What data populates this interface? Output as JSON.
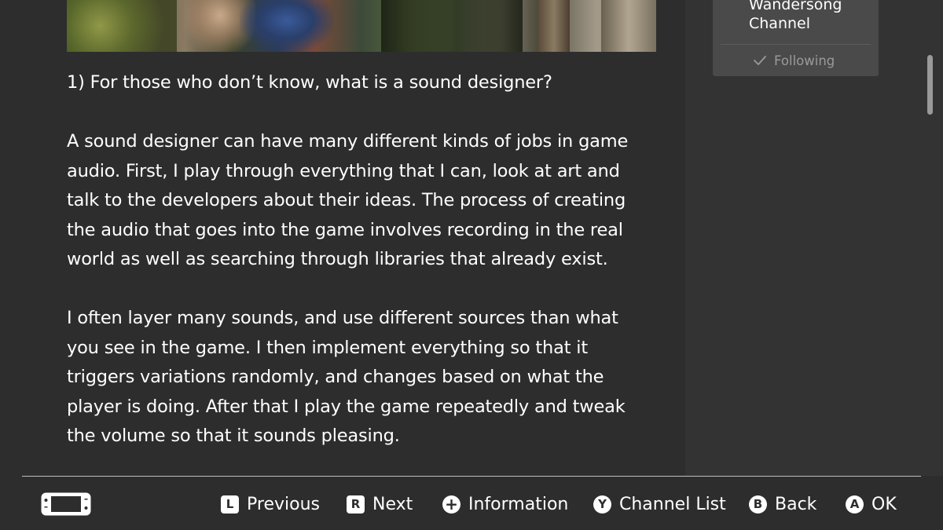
{
  "article": {
    "paragraphs": [
      "1) For those who don’t know, what is a sound designer?",
      "A sound designer can have many different kinds of jobs in game audio. First, I play through everything that I can, look at art and talk to the developers about their ideas. The process of creating the audio that goes into the game involves recording in the real world as well as searching through libraries that already exist.",
      "I often layer many sounds, and use different sources than what you see in the game. I then implement everything so that it triggers variations randomly, and changes based on what the player is doing. After that I play the game repeatedly and tweak the volume so that it sounds pleasing."
    ]
  },
  "channel": {
    "name": "Wandersong Channel",
    "follow_status": "Following",
    "follow_icon": "check-icon"
  },
  "footer": {
    "console_icon": "handheld-console-icon",
    "buttons": [
      {
        "key": "L",
        "label": "Previous"
      },
      {
        "key": "R",
        "label": "Next"
      },
      {
        "key": "+",
        "label": "Information"
      },
      {
        "key": "Y",
        "label": "Channel List"
      },
      {
        "key": "B",
        "label": "Back"
      },
      {
        "key": "A",
        "label": "OK"
      }
    ]
  },
  "colors": {
    "background": "#2d2d2d",
    "side_panel": "#333333",
    "card": "#4a4a4a",
    "text": "#ffffff",
    "muted_text": "#9a9a9a"
  }
}
